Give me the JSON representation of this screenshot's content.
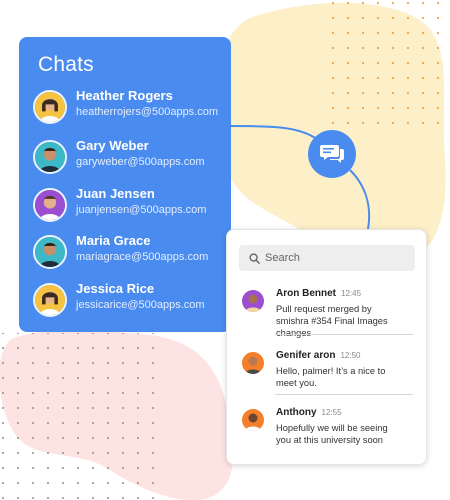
{
  "chats_panel": {
    "title": "Chats",
    "contacts": [
      {
        "name": "Heather Rogers",
        "email": "heatherrojers@500apps.com",
        "avatar": "avatar-woman-icon",
        "avatar_bg": "#f5c242"
      },
      {
        "name": "Gary Weber",
        "email": "garyweber@500apps.com",
        "avatar": "avatar-man-icon",
        "avatar_bg": "#3db8c6"
      },
      {
        "name": "Juan Jensen",
        "email": "juanjensen@500apps.com",
        "avatar": "avatar-man-icon",
        "avatar_bg": "#9b4fd0"
      },
      {
        "name": "Maria Grace",
        "email": "mariagrace@500apps.com",
        "avatar": "avatar-man-icon",
        "avatar_bg": "#3db8c6"
      },
      {
        "name": "Jessica Rice",
        "email": "jessicarice@500apps.com",
        "avatar": "avatar-woman-icon",
        "avatar_bg": "#f5c242"
      }
    ]
  },
  "chat_hub": {
    "icon": "chat-bubbles-icon"
  },
  "messages_card": {
    "search": {
      "placeholder": "Search",
      "icon": "search-icon"
    },
    "messages": [
      {
        "sender": "Aron Bennet",
        "time": "12:45",
        "text": "Pull request merged by smishra #354 Final Images changes",
        "avatar_bg": "#9b4fd0"
      },
      {
        "sender": "Genifer aron",
        "time": "12:50",
        "text": "Hello, palmer! It’s a nice to meet you.",
        "avatar_bg": "#f47f2a"
      },
      {
        "sender": "Anthony",
        "time": "12:55",
        "text": "Hopefully we will be seeing you at this university soon",
        "avatar_bg": "#f47f2a"
      }
    ]
  },
  "colors": {
    "accent_blue": "#4a8bef",
    "blob_yellow": "#fdefc8",
    "blob_pink": "#fde3e1",
    "dot_orange": "#f0a64a"
  }
}
